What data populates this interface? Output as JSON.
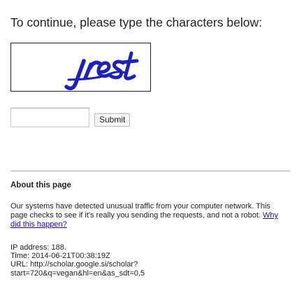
{
  "prompt": {
    "heading": "To continue, please type the characters below:"
  },
  "captcha": {
    "text": "jrest",
    "color": "#1f22b8"
  },
  "form": {
    "input_value": "",
    "submit_label": "Submit"
  },
  "about": {
    "title": "About this page",
    "paragraph_text": "Our systems have detected unusual traffic from your computer network. This page checks to see if it's really you sending the requests, and not a robot.",
    "link_text": "Why did this happen?"
  },
  "info": {
    "ip_line": "IP address: 188.",
    "time_line": "Time: 2014-06-21T00:38:19Z",
    "url_line_1": "URL: http://scholar.google.si/scholar?",
    "url_line_2": "start=720&q=vegan&hl=en&as_sdt=0,5"
  }
}
